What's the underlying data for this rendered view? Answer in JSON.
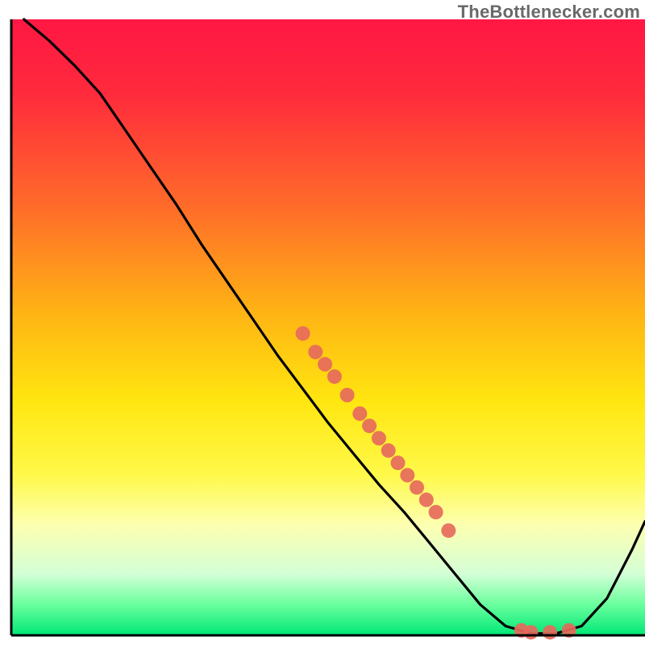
{
  "watermark": "TheBottlenecker.com",
  "chart_data": {
    "type": "line",
    "title": "",
    "xlabel": "",
    "ylabel": "",
    "xlim": [
      0,
      100
    ],
    "ylim": [
      0,
      100
    ],
    "grid": false,
    "background_gradient": {
      "stops": [
        {
          "offset": 0.0,
          "color": "#ff1744"
        },
        {
          "offset": 0.12,
          "color": "#ff2a3c"
        },
        {
          "offset": 0.3,
          "color": "#ff6a2a"
        },
        {
          "offset": 0.48,
          "color": "#ffb514"
        },
        {
          "offset": 0.62,
          "color": "#ffe610"
        },
        {
          "offset": 0.74,
          "color": "#fff94a"
        },
        {
          "offset": 0.82,
          "color": "#fdffb0"
        },
        {
          "offset": 0.9,
          "color": "#d4ffd6"
        },
        {
          "offset": 0.95,
          "color": "#6aff9e"
        },
        {
          "offset": 1.0,
          "color": "#00e876"
        }
      ]
    },
    "series": [
      {
        "name": "curve",
        "color": "#000000",
        "points": [
          {
            "x": 2.0,
            "y": 100.0
          },
          {
            "x": 6.0,
            "y": 96.5
          },
          {
            "x": 10.0,
            "y": 92.5
          },
          {
            "x": 14.0,
            "y": 88.0
          },
          {
            "x": 18.0,
            "y": 82.0
          },
          {
            "x": 22.0,
            "y": 76.0
          },
          {
            "x": 26.0,
            "y": 70.0
          },
          {
            "x": 30.0,
            "y": 63.5
          },
          {
            "x": 34.0,
            "y": 57.5
          },
          {
            "x": 38.0,
            "y": 51.5
          },
          {
            "x": 42.0,
            "y": 45.5
          },
          {
            "x": 46.0,
            "y": 40.0
          },
          {
            "x": 50.0,
            "y": 34.5
          },
          {
            "x": 54.0,
            "y": 29.5
          },
          {
            "x": 58.0,
            "y": 24.5
          },
          {
            "x": 62.0,
            "y": 20.0
          },
          {
            "x": 66.0,
            "y": 15.0
          },
          {
            "x": 70.0,
            "y": 10.0
          },
          {
            "x": 74.0,
            "y": 5.0
          },
          {
            "x": 78.0,
            "y": 1.5
          },
          {
            "x": 82.0,
            "y": 0.3
          },
          {
            "x": 86.0,
            "y": 0.3
          },
          {
            "x": 90.0,
            "y": 1.5
          },
          {
            "x": 94.0,
            "y": 6.0
          },
          {
            "x": 98.0,
            "y": 14.0
          },
          {
            "x": 100.0,
            "y": 18.5
          }
        ]
      }
    ],
    "scatter": {
      "name": "highlighted-points",
      "color": "#e66a5c",
      "radius": 9,
      "points": [
        {
          "x": 46.0,
          "y": 49.0
        },
        {
          "x": 48.0,
          "y": 46.0
        },
        {
          "x": 49.5,
          "y": 44.0
        },
        {
          "x": 51.0,
          "y": 42.0
        },
        {
          "x": 53.0,
          "y": 39.0
        },
        {
          "x": 55.0,
          "y": 36.0
        },
        {
          "x": 56.5,
          "y": 34.0
        },
        {
          "x": 58.0,
          "y": 32.0
        },
        {
          "x": 59.5,
          "y": 30.0
        },
        {
          "x": 61.0,
          "y": 28.0
        },
        {
          "x": 62.5,
          "y": 26.0
        },
        {
          "x": 64.0,
          "y": 24.0
        },
        {
          "x": 65.5,
          "y": 22.0
        },
        {
          "x": 67.0,
          "y": 20.0
        },
        {
          "x": 69.0,
          "y": 17.0
        },
        {
          "x": 80.5,
          "y": 0.8
        },
        {
          "x": 82.0,
          "y": 0.5
        },
        {
          "x": 85.0,
          "y": 0.5
        },
        {
          "x": 88.0,
          "y": 0.8
        }
      ]
    },
    "frame": {
      "strokes": [
        "left",
        "bottom"
      ],
      "color": "#000000",
      "width": 3
    }
  }
}
